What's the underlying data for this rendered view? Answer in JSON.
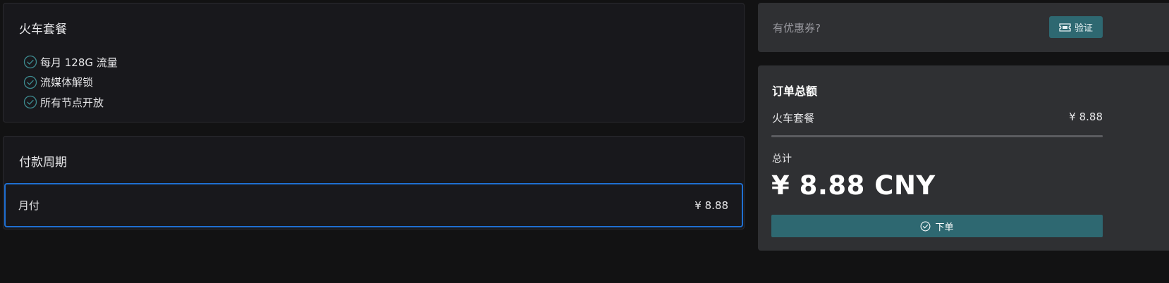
{
  "plan": {
    "title": "火车套餐",
    "features": [
      {
        "icon": "check-circle-icon",
        "label": "每月 128G 流量"
      },
      {
        "icon": "check-circle-icon",
        "label": "流媒体解锁"
      },
      {
        "icon": "check-circle-icon",
        "label": "所有节点开放"
      }
    ]
  },
  "period": {
    "title": "付款周期",
    "selected_option": {
      "name": "月付",
      "price": "¥ 8.88"
    }
  },
  "coupon": {
    "placeholder": "有优惠券?",
    "value": "",
    "verify_label": "验证",
    "verify_icon": "ticket-icon"
  },
  "summary": {
    "title": "订单总额",
    "line_item": {
      "name": "火车套餐",
      "price": "¥ 8.88"
    },
    "total_label": "总计",
    "total_value": "¥ 8.88 CNY",
    "order_label": "下单",
    "order_icon": "check-circle-icon"
  },
  "colors": {
    "background": "#121213",
    "card": "#18181c",
    "panel": "#2f3033",
    "accent": "#2e6871",
    "selected_border": "#1f6fd1",
    "check": "#3d8a8f"
  }
}
